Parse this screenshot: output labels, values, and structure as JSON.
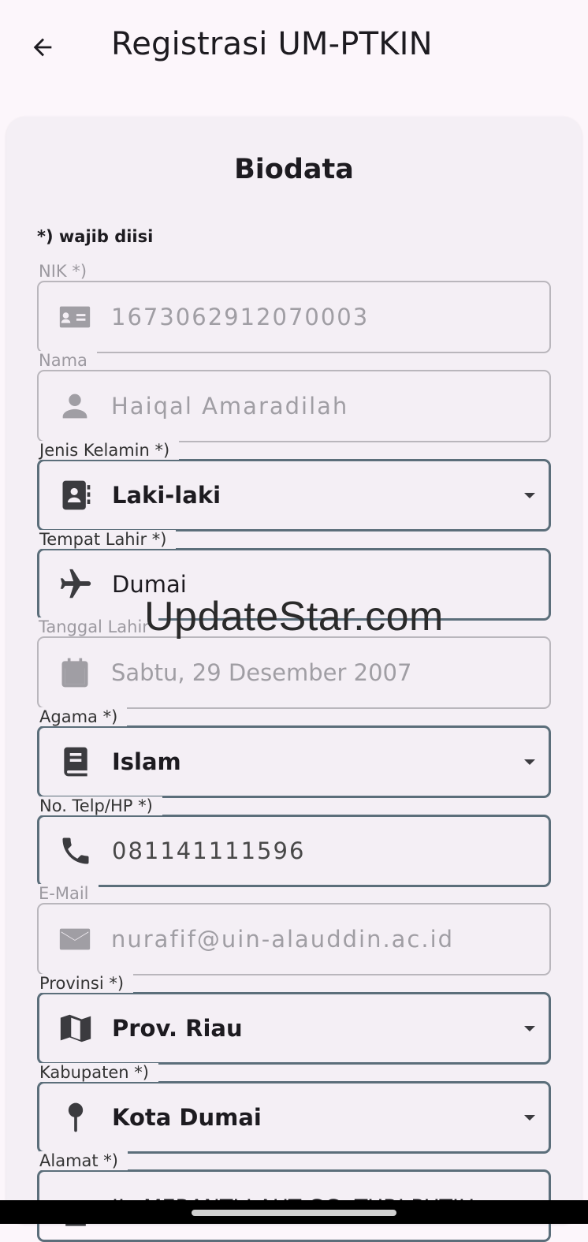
{
  "app_bar": {
    "title": "Registrasi UM-PTKIN",
    "back_icon": "arrow-left-icon"
  },
  "card": {
    "title": "Biodata",
    "required_note": "*) wajib diisi"
  },
  "fields": [
    {
      "label": "NIK *)",
      "value": "1673062912070003",
      "icon": "id-card-icon",
      "state": "disabled",
      "masked": true
    },
    {
      "label": "Nama",
      "value": "Haiqal Amaradilah",
      "icon": "person-icon",
      "state": "disabled",
      "masked": true
    },
    {
      "label": "Jenis Kelamin *)",
      "value": "Laki-laki",
      "icon": "contact-book-icon",
      "state": "active",
      "dropdown": true
    },
    {
      "label": "Tempat Lahir *)",
      "value": "Dumai",
      "icon": "airplane-icon",
      "state": "active"
    },
    {
      "label": "Tanggal Lahir",
      "value": "Sabtu, 29 Desember 2007",
      "icon": "calendar-icon",
      "state": "disabled"
    },
    {
      "label": "Agama *)",
      "value": "Islam",
      "icon": "book-icon",
      "state": "active",
      "dropdown": true
    },
    {
      "label": "No. Telp/HP *)",
      "value": "081141111596",
      "icon": "phone-icon",
      "state": "active",
      "masked": true
    },
    {
      "label": "E-Mail",
      "value": "nurafif@uin-alauddin.ac.id",
      "icon": "envelope-icon",
      "state": "disabled",
      "masked": true
    },
    {
      "label": "Provinsi *)",
      "value": "Prov. Riau",
      "icon": "map-icon",
      "state": "active",
      "dropdown": true
    },
    {
      "label": "Kabupaten *)",
      "value": "Kota Dumai",
      "icon": "map-pin-icon",
      "state": "active",
      "dropdown": true
    },
    {
      "label": "Alamat *)",
      "value": "JL. MERANTI LAUT GG. TURI PUTIH",
      "icon": "home-icon",
      "state": "active"
    }
  ],
  "watermark": "UpdateStar.com",
  "colors": {
    "background": "#fcf6fb",
    "card": "#f4eff5",
    "active_border": "#5b6e7a",
    "disabled_text": "#a09ea4",
    "icon": "#3b3b3f"
  }
}
